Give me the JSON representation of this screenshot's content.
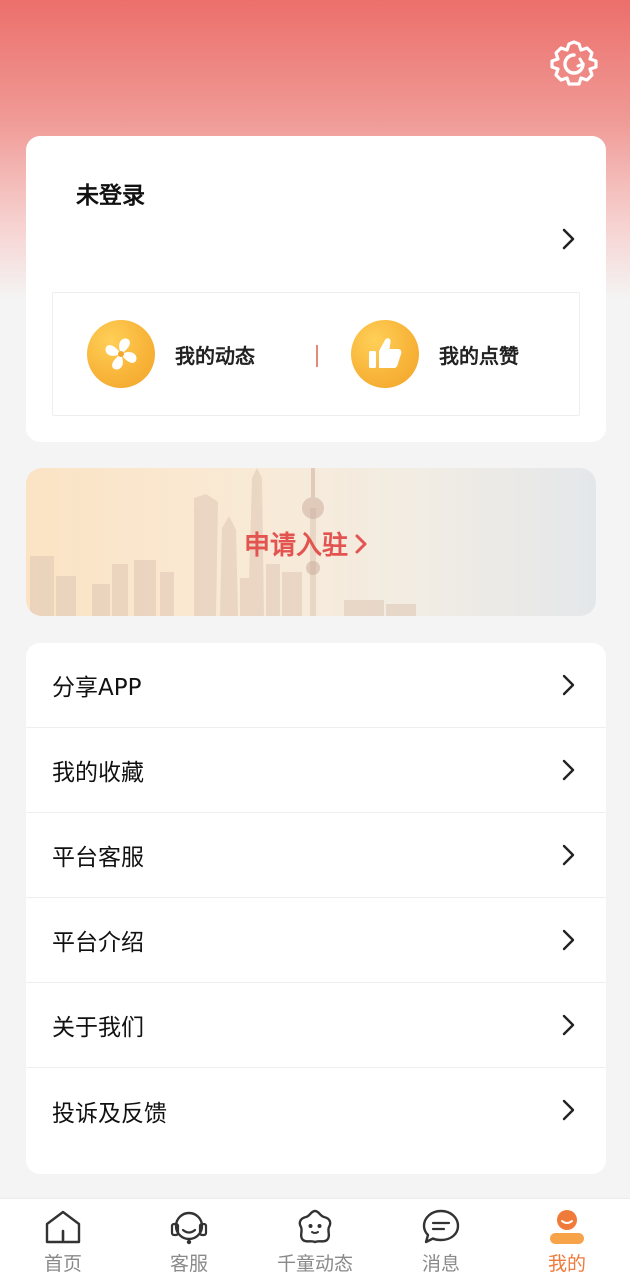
{
  "profile": {
    "login_status": "未登录"
  },
  "quick_actions": [
    {
      "label": "我的动态",
      "icon": "pinwheel-icon"
    },
    {
      "label": "我的点赞",
      "icon": "thumbs-up-icon"
    }
  ],
  "banner": {
    "text": "申请入驻"
  },
  "menu": [
    {
      "label": "分享APP"
    },
    {
      "label": "我的收藏"
    },
    {
      "label": "平台客服"
    },
    {
      "label": "平台介绍"
    },
    {
      "label": "关于我们"
    },
    {
      "label": "投诉及反馈"
    }
  ],
  "tabbar": {
    "items": [
      {
        "label": "首页",
        "icon": "home-icon"
      },
      {
        "label": "客服",
        "icon": "headset-icon"
      },
      {
        "label": "千童动态",
        "icon": "star-face-icon"
      },
      {
        "label": "消息",
        "icon": "chat-bubble-icon"
      },
      {
        "label": "我的",
        "icon": "user-icon"
      }
    ],
    "active_index": 4
  },
  "colors": {
    "accent": "#f07a3a",
    "header_gradient_top": "#ec6f6b",
    "banner_text": "#e35450",
    "icon_gold": "#f8b53a"
  }
}
